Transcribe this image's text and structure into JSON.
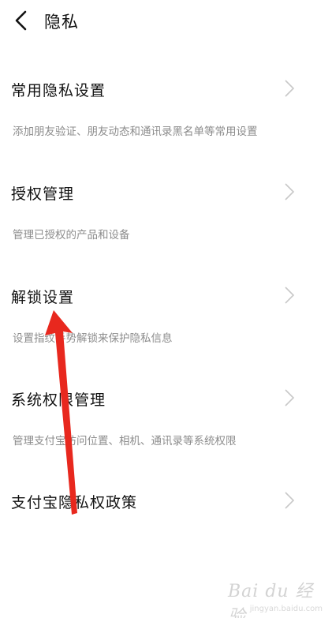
{
  "header": {
    "title": "隐私"
  },
  "items": [
    {
      "label": "常用隐私设置",
      "desc": "添加朋友验证、朋友动态和通讯录黑名单等常用设置"
    },
    {
      "label": "授权管理",
      "desc": "管理已授权的产品和设备"
    },
    {
      "label": "解锁设置",
      "desc": "设置指纹手势解锁来保护隐私信息"
    },
    {
      "label": "系统权限管理",
      "desc": "管理支付宝访问位置、相机、通讯录等系统权限"
    },
    {
      "label": "支付宝隐私权政策",
      "desc": ""
    }
  ],
  "colors": {
    "annotation_arrow": "#e8281e",
    "chevron": "#c8c8c8",
    "description": "#8c8c8c"
  },
  "watermark": {
    "main": "Bai du 经验",
    "sub": "jingyan.baidu.com"
  }
}
